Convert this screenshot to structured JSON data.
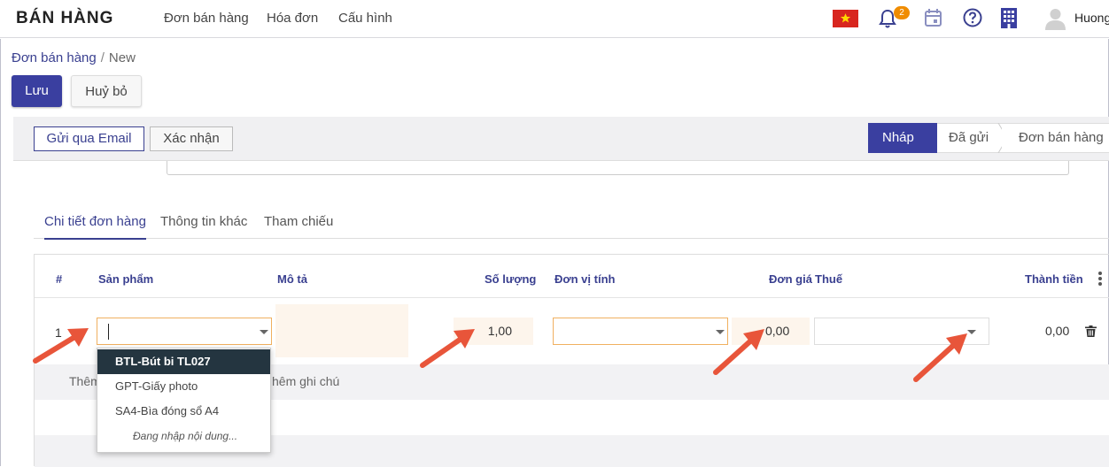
{
  "app": {
    "title": "BÁN HÀNG"
  },
  "menu": [
    "Đơn bán hàng",
    "Hóa đơn",
    "Cấu hình"
  ],
  "notifications": {
    "count": "2"
  },
  "user": {
    "name": "Huong"
  },
  "breadcrumb": {
    "parent": "Đơn bán hàng",
    "separator": "/",
    "current": "New"
  },
  "form_buttons": {
    "save": "Lưu",
    "discard": "Huỷ bỏ"
  },
  "actions": {
    "send_email": "Gửi qua Email",
    "confirm": "Xác nhận"
  },
  "stages": [
    {
      "label": "Nháp",
      "active": true
    },
    {
      "label": "Đã gửi",
      "active": false
    },
    {
      "label": "Đơn bán hàng",
      "active": false
    }
  ],
  "tabs": [
    "Chi tiết đơn hàng",
    "Thông tin khác",
    "Tham chiếu"
  ],
  "table": {
    "headers": [
      "#",
      "Sản phẩm",
      "Mô tả",
      "Số lượng",
      "Đơn vị tính",
      "Đơn giá",
      "Thuế",
      "Thành tiền"
    ],
    "row": {
      "num": "1",
      "quantity": "1,00",
      "price": "0,00",
      "total": "0,00"
    },
    "add_product": "Thêm",
    "add_note": "hêm ghi chú"
  },
  "dropdown": {
    "items": [
      "BTL-Bút bi TL027",
      "GPT-Giấy photo",
      "SA4-Bìa đóng sổ A4"
    ],
    "selected_index": 0,
    "loading": "Đang nhập nội dung..."
  },
  "colors": {
    "primary": "#3a3fa0",
    "accent": "#f08c00",
    "arrow": "#e8553a"
  }
}
